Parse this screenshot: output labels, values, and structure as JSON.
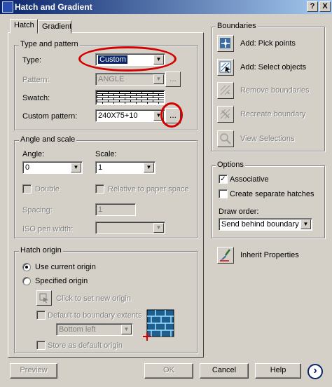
{
  "window": {
    "title": "Hatch and Gradient",
    "help_btn": "?",
    "close_btn": "X"
  },
  "tabs": [
    {
      "label": "Hatch"
    },
    {
      "label": "Gradient"
    }
  ],
  "type_pattern": {
    "title": "Type and pattern",
    "type_label": "Type:",
    "type_value": "Custom",
    "pattern_label": "Pattern:",
    "pattern_value": "ANGLE",
    "swatch_label": "Swatch:",
    "custom_label": "Custom pattern:",
    "custom_value": "240X75+10",
    "browse": "..."
  },
  "angle_scale": {
    "title": "Angle and scale",
    "angle_label": "Angle:",
    "angle_value": "0",
    "scale_label": "Scale:",
    "scale_value": "1",
    "double_label": "Double",
    "relative_label": "Relative to paper space",
    "spacing_label": "Spacing:",
    "spacing_value": "1",
    "iso_label": "ISO pen width:"
  },
  "hatch_origin": {
    "title": "Hatch origin",
    "use_current": "Use current origin",
    "specified": "Specified origin",
    "click_set": "Click to set new origin",
    "default_ext": "Default to boundary extents",
    "position_value": "Bottom left",
    "store_default": "Store as default origin"
  },
  "boundaries": {
    "title": "Boundaries",
    "add_pick": "Add: Pick points",
    "add_select": "Add: Select objects",
    "remove": "Remove boundaries",
    "recreate": "Recreate boundary",
    "view": "View Selections"
  },
  "options": {
    "title": "Options",
    "associative": "Associative",
    "separate": "Create separate hatches",
    "draw_order_label": "Draw order:",
    "draw_order_value": "Send behind boundary"
  },
  "inherit": {
    "label": "Inherit Properties"
  },
  "buttons": {
    "preview": "Preview",
    "ok": "OK",
    "cancel": "Cancel",
    "help": "Help",
    "more": "›"
  },
  "colors": {
    "title_start": "#0a246a",
    "title_end": "#a6caf0",
    "highlight": "#d40000",
    "selection": "#0a246a",
    "face": "#d4d0c8"
  }
}
